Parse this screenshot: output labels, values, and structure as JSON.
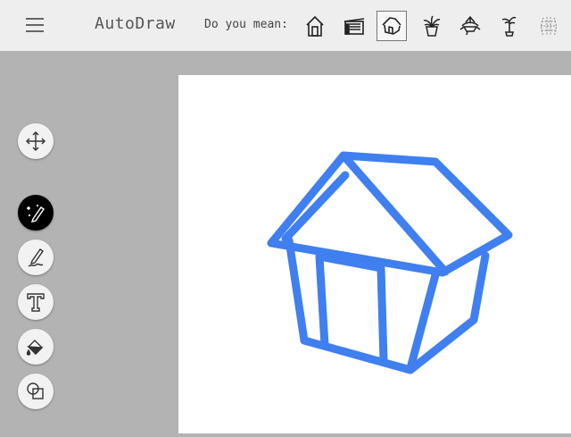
{
  "app": {
    "title": "AutoDraw"
  },
  "header": {
    "suggest_label": "Do you mean:",
    "suggestions": [
      {
        "icon": "tall-house-icon",
        "selected": false
      },
      {
        "icon": "shed-icon",
        "selected": false
      },
      {
        "icon": "house-icon",
        "selected": true
      },
      {
        "icon": "potted-plant-icon",
        "selected": false
      },
      {
        "icon": "hanging-plant-icon",
        "selected": false
      },
      {
        "icon": "palm-plant-icon",
        "selected": false
      },
      {
        "icon": "pattern-icon",
        "selected": false
      }
    ]
  },
  "toolbar": {
    "tools": [
      {
        "icon": "move-icon",
        "active": false
      },
      {
        "icon": "autodraw-icon",
        "active": true
      },
      {
        "icon": "draw-icon",
        "active": false
      },
      {
        "icon": "text-icon",
        "active": false
      },
      {
        "icon": "fill-icon",
        "active": false
      },
      {
        "icon": "shape-icon",
        "active": false
      }
    ]
  },
  "canvas": {
    "stroke_color": "#3f7ff0",
    "background": "#ffffff"
  }
}
